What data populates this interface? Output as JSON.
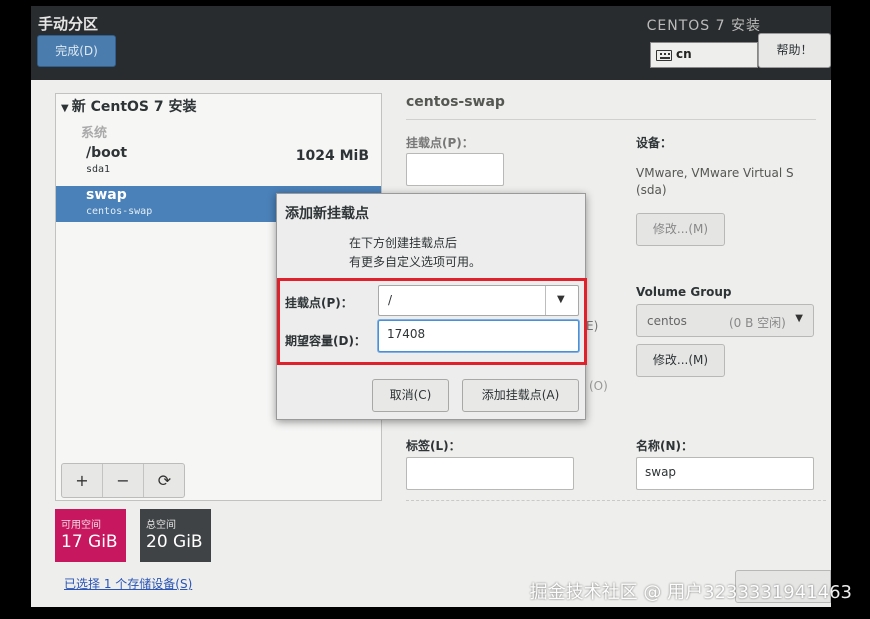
{
  "header": {
    "page_title": "手动分区",
    "done_label": "完成(D)",
    "product_title": "CENTOS 7 安装",
    "keyboard_layout": "cn",
    "help_label": "帮助！"
  },
  "partitions": {
    "install_title": "新 CentOS 7 安装",
    "system_label": "系统",
    "items": [
      {
        "name": "/boot",
        "device": "sda1",
        "size": "1024 MiB"
      },
      {
        "name": "swap",
        "device": "centos-swap",
        "size": ""
      }
    ],
    "toolbar": {
      "add": "+",
      "remove": "−",
      "refresh": "⟳"
    }
  },
  "space": {
    "available_label": "可用空间",
    "available_value": "17 GiB",
    "total_label": "总空间",
    "total_value": "20 GiB",
    "storage_link": "已选择 1 个存储设备(S)"
  },
  "details": {
    "title": "centos-swap",
    "mount_label": "挂载点(P)：",
    "device_label": "设备：",
    "device_value_line1": "VMware, VMware Virtual S",
    "device_value_line2": "(sda)",
    "modify1_label": "修改...(M)",
    "vg_label": "Volume Group",
    "vg_name": "centos",
    "vg_free": "(0 B 空闲)",
    "modify2_label": "修改...(M)",
    "partial_e": "E)",
    "partial_o": "(O)",
    "tag_label": "标签(L)：",
    "name_label": "名称(N)：",
    "name_value": "swap"
  },
  "dialog": {
    "title": "添加新挂载点",
    "message_line1": "在下方创建挂载点后",
    "message_line2": "有更多自定义选项可用。",
    "mount_label": "挂载点(P)：",
    "mount_value": "/",
    "capacity_label": "期望容量(D)：",
    "capacity_value": "17408",
    "cancel_label": "取消(C)",
    "add_label": "添加挂载点(A)"
  },
  "watermark": "掘金技术社区 @ 用户3233331941463",
  "colors": {
    "accent": "#4a81b8",
    "available": "#c7175e",
    "total": "#404346",
    "highlight": "#e0202a"
  }
}
